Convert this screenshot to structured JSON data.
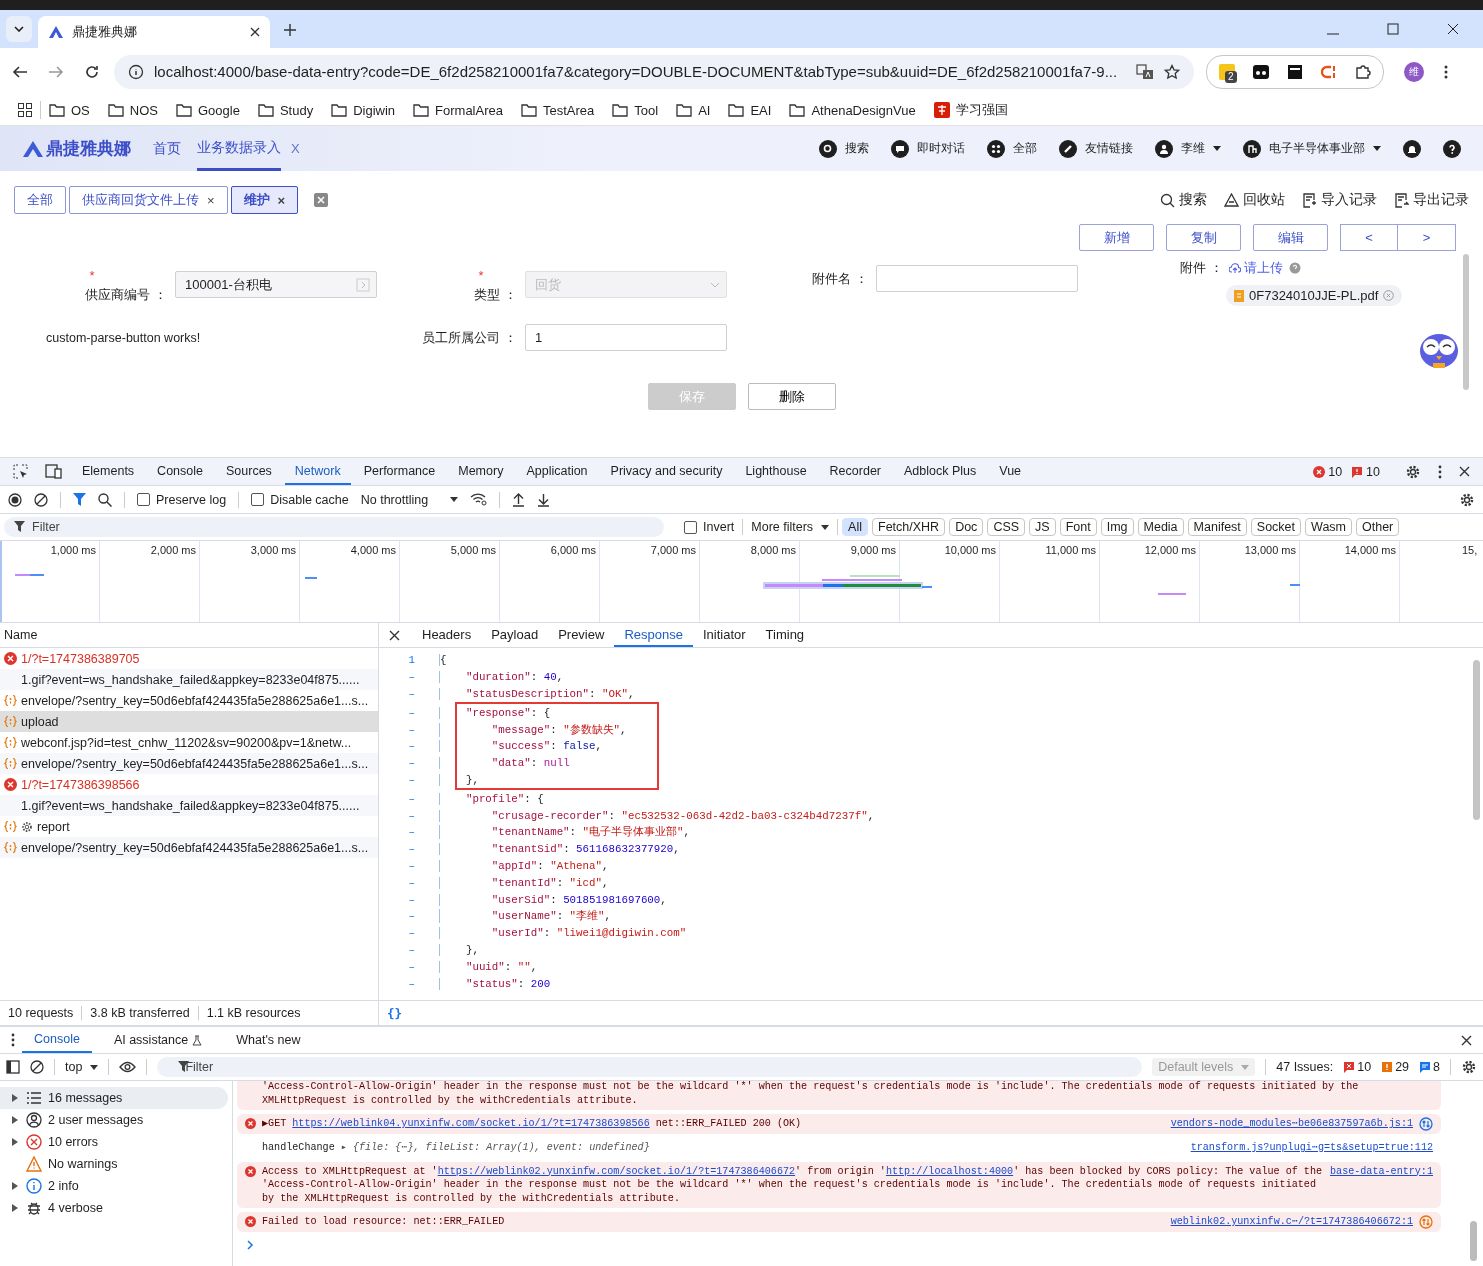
{
  "browser": {
    "tab_title": "鼎捷雅典娜",
    "url": "localhost:4000/base-data-entry?code=DE_6f2d258210001fa7&category=DOUBLE-DOCUMENT&tabType=sub&uuid=DE_6f2d258210001fa7-9...",
    "extension_badge": "2",
    "profile_initial": "维",
    "bookmarks": [
      {
        "label": "OS",
        "kind": "folder"
      },
      {
        "label": "NOS",
        "kind": "folder"
      },
      {
        "label": "Google",
        "kind": "folder"
      },
      {
        "label": "Study",
        "kind": "folder"
      },
      {
        "label": "Digiwin",
        "kind": "folder"
      },
      {
        "label": "FormalArea",
        "kind": "folder"
      },
      {
        "label": "TestArea",
        "kind": "folder"
      },
      {
        "label": "Tool",
        "kind": "folder"
      },
      {
        "label": "AI",
        "kind": "folder"
      },
      {
        "label": "EAI",
        "kind": "folder"
      },
      {
        "label": "AthenaDesignVue",
        "kind": "folder"
      },
      {
        "label": "学习强国",
        "kind": "site"
      }
    ]
  },
  "app": {
    "logo": "鼎捷雅典娜",
    "nav": [
      {
        "label": "首页",
        "selected": false
      },
      {
        "label": "业务数据录入",
        "selected": true,
        "close": "X"
      }
    ],
    "header_actions": [
      {
        "label": "搜索",
        "kind": "search",
        "dropdown": false
      },
      {
        "label": "即时对话",
        "kind": "chat",
        "dropdown": false
      },
      {
        "label": "全部",
        "kind": "grid",
        "dropdown": false
      },
      {
        "label": "友情链接",
        "kind": "link",
        "dropdown": false
      },
      {
        "label": "李维",
        "kind": "user",
        "dropdown": true
      },
      {
        "label": "电子半导体事业部",
        "kind": "org",
        "dropdown": true
      }
    ],
    "page_tabs": [
      {
        "label": "全部",
        "selected": false
      },
      {
        "label": "供应商回货文件上传",
        "selected": false,
        "close": "×"
      },
      {
        "label": "维护",
        "selected": true,
        "close": "×"
      }
    ],
    "toolbar_links": [
      {
        "label": "搜索",
        "kind": "search"
      },
      {
        "label": "回收站",
        "kind": "recycle"
      },
      {
        "label": "导入记录",
        "kind": "import"
      },
      {
        "label": "导出记录",
        "kind": "export"
      }
    ],
    "record_buttons": [
      "新增",
      "复制",
      "编辑"
    ],
    "pager": [
      "<",
      ">"
    ],
    "fields": [
      {
        "required_mark": "*",
        "label": "供应商编号 ：",
        "value": "100001-台积电",
        "kind": "lookup",
        "disabled": false
      },
      {
        "required_mark": "*",
        "label": "类型 ：",
        "value": "回货",
        "kind": "select",
        "disabled": true
      },
      {
        "label": "附件名 ：",
        "kind": "text",
        "disabled": false
      }
    ],
    "attachment": {
      "label": "附件 ：",
      "upload": "请上传",
      "file": "0F7324010JJE-PL.pdf"
    },
    "message": "custom-parse-button works!",
    "company_field": {
      "label": "员工所属公司 ：",
      "value": "1"
    },
    "actions": [
      {
        "label": "保存",
        "disabled": true
      },
      {
        "label": "删除",
        "disabled": false
      }
    ]
  },
  "devtools": {
    "tabs": [
      {
        "label": "Elements",
        "selected": false
      },
      {
        "label": "Console",
        "selected": false
      },
      {
        "label": "Sources",
        "selected": false
      },
      {
        "label": "Network",
        "selected": true
      },
      {
        "label": "Performance",
        "selected": false
      },
      {
        "label": "Memory",
        "selected": false
      },
      {
        "label": "Application",
        "selected": false
      },
      {
        "label": "Privacy and security",
        "selected": false
      },
      {
        "label": "Lighthouse",
        "selected": false
      },
      {
        "label": "Recorder",
        "selected": false
      },
      {
        "label": "Adblock Plus",
        "selected": false
      },
      {
        "label": "Vue",
        "selected": false
      }
    ],
    "error_count": "10",
    "warning_count": "10",
    "preserve_log": {
      "label": "Preserve log",
      "checked": false
    },
    "disable_cache": {
      "label": "Disable cache",
      "checked": false
    },
    "throttling": "No throttling",
    "filter": {
      "placeholder": "Filter"
    },
    "invert": {
      "label": "Invert",
      "checked": false
    },
    "more_filters": "More filters",
    "type_filters": [
      {
        "label": "All",
        "selected": true
      },
      {
        "label": "Fetch/XHR",
        "selected": false
      },
      {
        "label": "Doc",
        "selected": false
      },
      {
        "label": "CSS",
        "selected": false
      },
      {
        "label": "JS",
        "selected": false
      },
      {
        "label": "Font",
        "selected": false
      },
      {
        "label": "Img",
        "selected": false
      },
      {
        "label": "Media",
        "selected": false
      },
      {
        "label": "Manifest",
        "selected": false
      },
      {
        "label": "Socket",
        "selected": false
      },
      {
        "label": "Wasm",
        "selected": false
      },
      {
        "label": "Other",
        "selected": false
      }
    ],
    "timeline_ticks": [
      "1,000 ms",
      "2,000 ms",
      "3,000 ms",
      "4,000 ms",
      "5,000 ms",
      "6,000 ms",
      "7,000 ms",
      "8,000 ms",
      "9,000 ms",
      "10,000 ms",
      "11,000 ms",
      "12,000 ms",
      "13,000 ms",
      "14,000 ms",
      "15,"
    ],
    "name_header": "Name",
    "requests": [
      {
        "name": "1/?t=1747386389705",
        "kind": "error",
        "selected": false
      },
      {
        "name": "1.gif?event=ws_handshake_failed&appkey=8233e04f875......",
        "kind": "image",
        "selected": false
      },
      {
        "name": "envelope/?sentry_key=50d6ebfaf424435fa5e288625a6e1...s...",
        "kind": "fetch",
        "selected": false
      },
      {
        "name": "upload",
        "kind": "fetch",
        "selected": true
      },
      {
        "name": "webconf.jsp?id=test_cnhw_11202&sv=90200&pv=1&netw...",
        "kind": "fetch",
        "selected": false
      },
      {
        "name": "envelope/?sentry_key=50d6ebfaf424435fa5e288625a6e1...s...",
        "kind": "fetch",
        "selected": false
      },
      {
        "name": "1/?t=1747386398566",
        "kind": "error",
        "selected": false
      },
      {
        "name": "1.gif?event=ws_handshake_failed&appkey=8233e04f875......",
        "kind": "image",
        "selected": false
      },
      {
        "name": "report",
        "kind": "preflight",
        "selected": false
      },
      {
        "name": "envelope/?sentry_key=50d6ebfaf424435fa5e288625a6e1...s...",
        "kind": "fetch",
        "selected": false
      }
    ],
    "detail_tabs": [
      {
        "label": "Headers",
        "selected": false
      },
      {
        "label": "Payload",
        "selected": false
      },
      {
        "label": "Preview",
        "selected": false
      },
      {
        "label": "Response",
        "selected": true
      },
      {
        "label": "Initiator",
        "selected": false
      },
      {
        "label": "Timing",
        "selected": false
      }
    ],
    "response": [
      {
        "highlight": false,
        "lines": [
          {
            "gutter": "1",
            "code": "{"
          },
          {
            "gutter": "–",
            "code": "    \"duration\": 40,"
          },
          {
            "gutter": "–",
            "code": "    \"statusDescription\": \"OK\","
          }
        ]
      },
      {
        "highlight": true,
        "lines": [
          {
            "gutter": "–",
            "code": "    \"response\": {"
          },
          {
            "gutter": "–",
            "code": "        \"message\": \"参数缺失\","
          },
          {
            "gutter": "–",
            "code": "        \"success\": false,"
          },
          {
            "gutter": "–",
            "code": "        \"data\": null"
          },
          {
            "gutter": "–",
            "code": "    },"
          }
        ]
      },
      {
        "highlight": false,
        "lines": [
          {
            "gutter": "–",
            "code": "    \"profile\": {"
          },
          {
            "gutter": "–",
            "code": "        \"crusage-recorder\": \"ec532532-063d-42d2-ba03-c324b4d7237f\","
          },
          {
            "gutter": "–",
            "code": "        \"tenantName\": \"电子半导体事业部\","
          },
          {
            "gutter": "–",
            "code": "        \"tenantSid\": 561168632377920,"
          },
          {
            "gutter": "–",
            "code": "        \"appId\": \"Athena\","
          },
          {
            "gutter": "–",
            "code": "        \"tenantId\": \"icd\","
          },
          {
            "gutter": "–",
            "code": "        \"userSid\": 501851981697600,"
          },
          {
            "gutter": "–",
            "code": "        \"userName\": \"李维\","
          },
          {
            "gutter": "–",
            "code": "        \"userId\": \"liwei1@digiwin.com\""
          },
          {
            "gutter": "–",
            "code": "    },"
          },
          {
            "gutter": "–",
            "code": "    \"uuid\": \"\","
          },
          {
            "gutter": "–",
            "code": "    \"status\": 200"
          }
        ]
      }
    ],
    "status": [
      "10 requests",
      "3.8 kB transferred",
      "1.1 kB resources"
    ],
    "format_button": "{}"
  },
  "drawer": {
    "tabs": [
      {
        "label": "Console",
        "selected": true,
        "kind": "plain"
      },
      {
        "label": "AI assistance",
        "selected": false,
        "kind": "lab"
      },
      {
        "label": "What's new",
        "selected": false,
        "kind": "plain"
      }
    ],
    "context": "top",
    "filter": {
      "placeholder": "Filter"
    },
    "levels": "Default levels",
    "issues_label": "47 Issues:",
    "issue_counts": [
      {
        "kind": "error",
        "count": "10"
      },
      {
        "kind": "warning",
        "count": "29"
      },
      {
        "kind": "info",
        "count": "8"
      }
    ],
    "sidebar": [
      {
        "label": "16 messages",
        "kind": "list",
        "expandable": true,
        "selected": true
      },
      {
        "label": "2 user messages",
        "kind": "user",
        "expandable": true,
        "selected": false
      },
      {
        "label": "10 errors",
        "kind": "error",
        "expandable": true,
        "selected": false
      },
      {
        "label": "No warnings",
        "kind": "warning",
        "expandable": false,
        "selected": false
      },
      {
        "label": "2 info",
        "kind": "info",
        "expandable": true,
        "selected": false
      },
      {
        "label": "4 verbose",
        "kind": "verbose",
        "expandable": true,
        "selected": false
      }
    ],
    "messages": [
      {
        "kind": "error",
        "icon": false,
        "parts": [
          {
            "kind": "text",
            "text": "'Access-Control-Allow-Origin' header in the response must not be the wildcard '*' when the request's credentials mode is 'include'. The credentials mode of requests initiated by the XMLHttpRequest is controlled by the withCredentials attribute."
          }
        ]
      },
      {
        "kind": "error",
        "icon": true,
        "parts": [
          {
            "kind": "text",
            "text": "▶GET "
          },
          {
            "kind": "link",
            "text": "https://weblink04.yunxinfw.com/socket.io/1/?t=1747386398566"
          },
          {
            "kind": "text",
            "text": " net::ERR_FAILED 200 (OK)"
          }
        ],
        "source": "vendors-node_modules⋯be06e837597a6b.js:1",
        "color": "#1a73e8"
      },
      {
        "kind": "log",
        "icon": false,
        "parts": [
          {
            "kind": "text",
            "text": "handleChange "
          },
          {
            "kind": "object",
            "text": "▸ {file: {⋯}, fileList: Array(1), event: undefined}"
          }
        ],
        "source": "transform.js?unplugi⋯g=ts&setup=true:112"
      },
      {
        "kind": "error",
        "icon": true,
        "parts": [
          {
            "kind": "text",
            "text": "Access to XMLHttpRequest at '"
          },
          {
            "kind": "link",
            "text": "https://weblink02.yunxinfw.com/socket.io/1/?t=1747386406672"
          },
          {
            "kind": "text",
            "text": "' from origin '"
          },
          {
            "kind": "link",
            "text": "http://localhost:4000"
          },
          {
            "kind": "text",
            "text": "' has been blocked by CORS policy: The value of the 'Access-Control-Allow-Origin' header in the response must not be the wildcard '*' when the request's credentials mode is 'include'. The credentials mode of requests initiated by the XMLHttpRequest is controlled by the withCredentials attribute."
          }
        ],
        "source": "base-data-entry:1"
      },
      {
        "kind": "error",
        "icon": true,
        "parts": [
          {
            "kind": "text",
            "text": "Failed to load resource: net::ERR_FAILED"
          }
        ],
        "source": "weblink02.yunxinfw.c⋯/?t=1747386406672:1",
        "color": "#e8710a"
      }
    ]
  }
}
